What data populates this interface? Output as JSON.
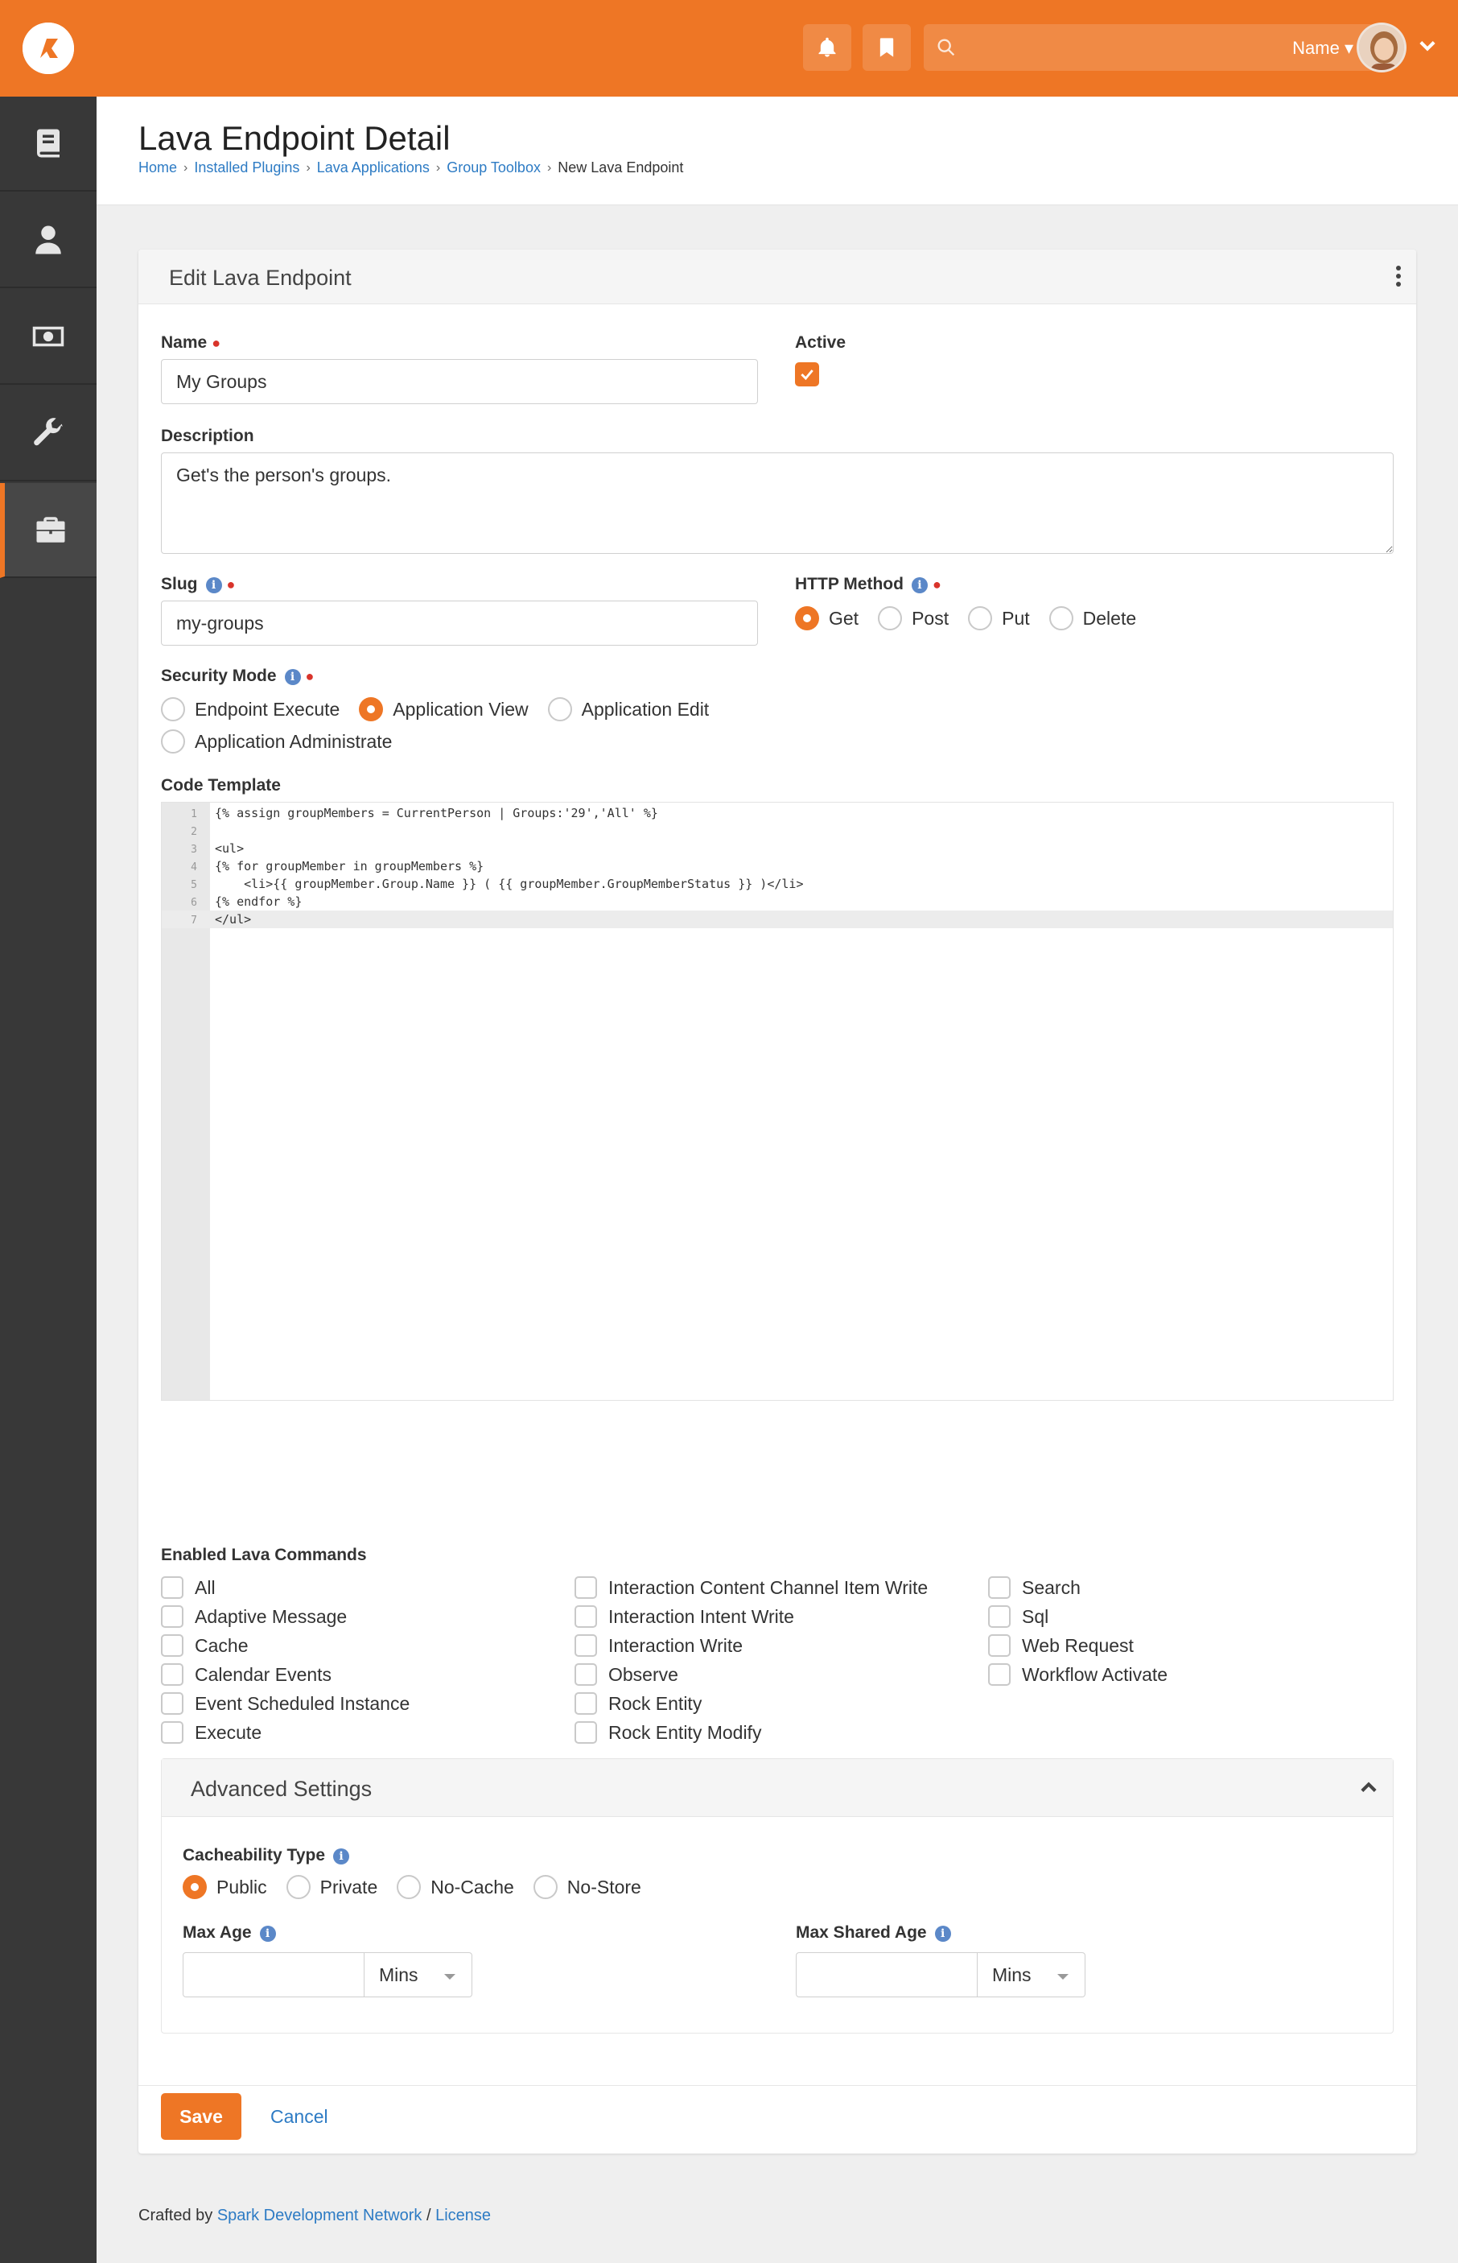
{
  "topbar": {
    "search_filter_label": "Name ▾",
    "accent_color": "#ee7625",
    "icons": [
      "bell-icon",
      "bookmark-icon",
      "search-icon",
      "chevron-down-icon"
    ]
  },
  "sidebar": {
    "items": [
      {
        "name": "notes",
        "icon": "book-icon"
      },
      {
        "name": "people",
        "icon": "person-icon"
      },
      {
        "name": "finance",
        "icon": "money-icon"
      },
      {
        "name": "admin-tools",
        "icon": "wrench-icon"
      },
      {
        "name": "plugins",
        "icon": "briefcase-icon",
        "active": true
      }
    ]
  },
  "page": {
    "title": "Lava Endpoint Detail",
    "breadcrumb": [
      "Home",
      "Installed Plugins",
      "Lava Applications",
      "Group Toolbox",
      "New Lava Endpoint"
    ]
  },
  "panel": {
    "title": "Edit Lava Endpoint"
  },
  "form": {
    "name_label": "Name",
    "name_value": "My Groups",
    "active_label": "Active",
    "active_checked": true,
    "description_label": "Description",
    "description_value": "Get's the person's groups.",
    "slug_label": "Slug",
    "slug_value": "my-groups",
    "http_method_label": "HTTP Method",
    "http_methods": [
      "Get",
      "Post",
      "Put",
      "Delete"
    ],
    "http_method_selected": "Get",
    "security_mode_label": "Security Mode",
    "security_modes": [
      "Endpoint Execute",
      "Application View",
      "Application Edit",
      "Application Administrate"
    ],
    "security_mode_selected": "Application View",
    "code_template_label": "Code Template",
    "code_lines": [
      "{% assign groupMembers = CurrentPerson | Groups:'29','All' %}",
      "",
      "<ul>",
      "{% for groupMember in groupMembers %}",
      "    <li>{{ groupMember.Group.Name }} ( {{ groupMember.GroupMemberStatus }} )</li>",
      "{% endfor %}",
      "</ul>"
    ],
    "lava_commands_label": "Enabled Lava Commands",
    "lava_commands": {
      "col1": [
        "All",
        "Adaptive Message",
        "Cache",
        "Calendar Events",
        "Event Scheduled Instance",
        "Execute"
      ],
      "col2": [
        "Interaction Content Channel Item Write",
        "Interaction Intent Write",
        "Interaction Write",
        "Observe",
        "Rock Entity",
        "Rock Entity Modify"
      ],
      "col3": [
        "Search",
        "Sql",
        "Web Request",
        "Workflow Activate"
      ]
    }
  },
  "advanced": {
    "title": "Advanced Settings",
    "cacheability_label": "Cacheability Type",
    "cacheability_options": [
      "Public",
      "Private",
      "No-Cache",
      "No-Store"
    ],
    "cacheability_selected": "Public",
    "max_age_label": "Max Age",
    "max_age_unit": "Mins",
    "max_shared_age_label": "Max Shared Age",
    "max_shared_age_unit": "Mins"
  },
  "actions": {
    "save_label": "Save",
    "cancel_label": "Cancel"
  },
  "footer": {
    "crafted_by": "Crafted by",
    "link_network": "Spark Development Network",
    "separator": "/",
    "link_license": "License"
  }
}
